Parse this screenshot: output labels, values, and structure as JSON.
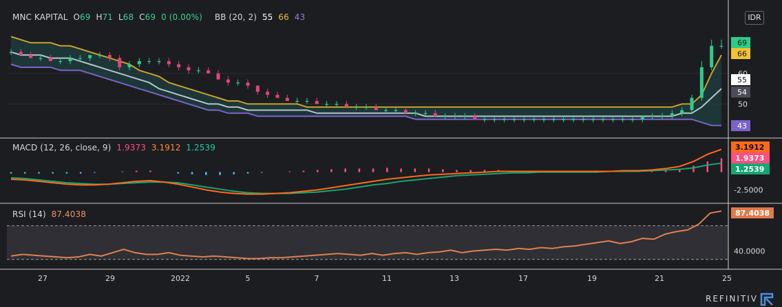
{
  "header": {
    "symbol": "MNC KAPITAL",
    "o_label": "O",
    "o": "69",
    "h_label": "H",
    "h": "71",
    "l_label": "L",
    "l": "68",
    "c_label": "C",
    "c": "69",
    "change": "0 (0.00%)",
    "bb_label": "BB (20, 2)",
    "bb_mid": "55",
    "bb_upper": "66",
    "bb_lower": "43",
    "currency": "IDR"
  },
  "macd_header": {
    "label": "MACD (12, 26, close, 9)",
    "hist": "1.9373",
    "macd": "3.1912",
    "signal": "1.2539"
  },
  "rsi_header": {
    "label": "RSI (14)",
    "value": "87.4038"
  },
  "footer": {
    "brand": "REFINITIV"
  },
  "colors": {
    "up": "#2ecc8a",
    "down": "#e0457b",
    "bb_upper": "#c9a227",
    "bb_mid": "#b8c4c9",
    "bb_lower": "#7c63c9",
    "macd": "#ff6a1a",
    "signal": "#17a673",
    "hist_pos": "#ff4f80",
    "hist_neg": "#4fc3f7",
    "rsi": "#e08050"
  },
  "chart_data": [
    {
      "type": "candlestick",
      "title": "MNC KAPITAL",
      "ylim": [
        40,
        75
      ],
      "yticks": [
        50,
        60
      ],
      "price_tags": [
        "69",
        "66",
        "55",
        "54",
        "43"
      ],
      "x_ticks": [
        "27",
        "29",
        "2022",
        "5",
        "7",
        "11",
        "13",
        "17",
        "19",
        "21",
        "25"
      ],
      "candles": [
        [
          67,
          68,
          66,
          67
        ],
        [
          67,
          68,
          66,
          66
        ],
        [
          66,
          67,
          65,
          65
        ],
        [
          65,
          66,
          64,
          65
        ],
        [
          65,
          66,
          64,
          64
        ],
        [
          64,
          65,
          63,
          64
        ],
        [
          64,
          66,
          63,
          65
        ],
        [
          65,
          66,
          64,
          65
        ],
        [
          65,
          66,
          64,
          66
        ],
        [
          66,
          67,
          65,
          66
        ],
        [
          66,
          67,
          64,
          65
        ],
        [
          65,
          66,
          61,
          62
        ],
        [
          62,
          64,
          61,
          63
        ],
        [
          63,
          65,
          62,
          64
        ],
        [
          64,
          65,
          63,
          64
        ],
        [
          64,
          65,
          63,
          64
        ],
        [
          64,
          65,
          62,
          63
        ],
        [
          63,
          64,
          61,
          62
        ],
        [
          62,
          63,
          60,
          61
        ],
        [
          61,
          62,
          60,
          61
        ],
        [
          61,
          62,
          60,
          60
        ],
        [
          60,
          61,
          58,
          58
        ],
        [
          58,
          59,
          56,
          57
        ],
        [
          57,
          58,
          56,
          57
        ],
        [
          57,
          58,
          55,
          56
        ],
        [
          56,
          56,
          53,
          54
        ],
        [
          54,
          55,
          52,
          53
        ],
        [
          53,
          54,
          52,
          52
        ],
        [
          52,
          53,
          51,
          51
        ],
        [
          51,
          52,
          50,
          51
        ],
        [
          51,
          52,
          50,
          51
        ],
        [
          51,
          52,
          50,
          50
        ],
        [
          50,
          51,
          49,
          50
        ],
        [
          50,
          51,
          49,
          50
        ],
        [
          50,
          51,
          49,
          49
        ],
        [
          49,
          50,
          48,
          49
        ],
        [
          49,
          50,
          48,
          49
        ],
        [
          49,
          50,
          48,
          48
        ],
        [
          48,
          49,
          47,
          48
        ],
        [
          48,
          49,
          47,
          48
        ],
        [
          48,
          49,
          47,
          47
        ],
        [
          47,
          48,
          46,
          47
        ],
        [
          47,
          48,
          46,
          47
        ],
        [
          47,
          48,
          46,
          46
        ],
        [
          46,
          47,
          45,
          46
        ],
        [
          46,
          47,
          45,
          46
        ],
        [
          46,
          47,
          45,
          46
        ],
        [
          46,
          47,
          45,
          45
        ],
        [
          45,
          46,
          44,
          45
        ],
        [
          45,
          46,
          44,
          45
        ],
        [
          45,
          46,
          44,
          45
        ],
        [
          45,
          46,
          44,
          45
        ],
        [
          45,
          46,
          44,
          45
        ],
        [
          45,
          46,
          44,
          45
        ],
        [
          45,
          46,
          44,
          45
        ],
        [
          45,
          46,
          44,
          45
        ],
        [
          45,
          46,
          44,
          45
        ],
        [
          45,
          46,
          44,
          45
        ],
        [
          45,
          46,
          44,
          45
        ],
        [
          45,
          46,
          44,
          45
        ],
        [
          45,
          46,
          44,
          45
        ],
        [
          45,
          46,
          44,
          45
        ],
        [
          45,
          46,
          44,
          45
        ],
        [
          45,
          46,
          44,
          45
        ],
        [
          45,
          46,
          44,
          46
        ],
        [
          46,
          47,
          45,
          46
        ],
        [
          46,
          47,
          45,
          46
        ],
        [
          46,
          48,
          45,
          47
        ],
        [
          47,
          49,
          46,
          48
        ],
        [
          48,
          53,
          47,
          52
        ],
        [
          52,
          64,
          51,
          62
        ],
        [
          62,
          71,
          61,
          69
        ],
        [
          69,
          71,
          68,
          69
        ]
      ],
      "bb_upper": [
        72,
        71,
        70,
        70,
        70,
        69,
        69,
        68,
        67,
        66,
        65,
        64,
        63,
        61,
        60,
        59,
        57,
        56,
        55,
        54,
        53,
        52,
        51,
        51,
        50,
        50,
        50,
        50,
        50,
        50,
        49,
        49,
        49,
        49,
        49,
        49,
        49,
        49,
        49,
        49,
        49,
        49,
        49,
        49,
        49,
        49,
        49,
        49,
        49,
        49,
        49,
        49,
        49,
        49,
        49,
        49,
        49,
        49,
        49,
        49,
        49,
        49,
        49,
        49,
        49,
        49,
        49,
        49,
        50,
        50,
        53,
        60,
        66
      ],
      "bb_mid": [
        67,
        66,
        66,
        66,
        65,
        65,
        65,
        64,
        63,
        62,
        61,
        60,
        59,
        58,
        57,
        55,
        54,
        53,
        52,
        51,
        50,
        50,
        49,
        49,
        48,
        48,
        48,
        48,
        48,
        48,
        48,
        47,
        47,
        47,
        47,
        47,
        47,
        47,
        47,
        47,
        47,
        47,
        46,
        46,
        46,
        46,
        46,
        46,
        46,
        46,
        46,
        46,
        46,
        46,
        46,
        46,
        46,
        46,
        46,
        46,
        46,
        46,
        46,
        46,
        46,
        46,
        46,
        46,
        47,
        47,
        49,
        52,
        55
      ],
      "bb_lower": [
        63,
        62,
        62,
        62,
        62,
        61,
        61,
        61,
        60,
        59,
        58,
        57,
        56,
        55,
        54,
        53,
        52,
        51,
        50,
        49,
        48,
        48,
        47,
        47,
        47,
        46,
        46,
        46,
        46,
        46,
        46,
        46,
        46,
        46,
        46,
        46,
        46,
        46,
        46,
        46,
        46,
        45,
        45,
        45,
        45,
        45,
        45,
        45,
        45,
        45,
        45,
        45,
        45,
        45,
        45,
        45,
        45,
        45,
        45,
        45,
        45,
        45,
        45,
        45,
        45,
        45,
        45,
        45,
        45,
        45,
        44,
        43,
        43
      ]
    },
    {
      "type": "line",
      "title": "MACD (12, 26, close, 9)",
      "ylim": [
        -4,
        4.5
      ],
      "yticks": [
        -2.5
      ],
      "series": [
        {
          "name": "MACD",
          "values": [
            -1,
            -1.1,
            -1.3,
            -1.5,
            -1.7,
            -1.8,
            -1.8,
            -1.7,
            -1.5,
            -1.3,
            -1.2,
            -1.4,
            -1.7,
            -2.1,
            -2.5,
            -2.8,
            -3.0,
            -3.1,
            -3.1,
            -3.0,
            -2.9,
            -2.7,
            -2.5,
            -2.2,
            -1.9,
            -1.6,
            -1.3,
            -1.0,
            -0.8,
            -0.6,
            -0.4,
            -0.3,
            -0.2,
            -0.1,
            0,
            0.1,
            0.1,
            0.1,
            0.1,
            0.1,
            0.1,
            0.1,
            0.1,
            0.1,
            0.2,
            0.2,
            0.3,
            0.5,
            0.8,
            1.5,
            2.5,
            3.2
          ]
        },
        {
          "name": "Signal",
          "values": [
            -0.8,
            -0.9,
            -1.1,
            -1.3,
            -1.5,
            -1.6,
            -1.7,
            -1.7,
            -1.6,
            -1.5,
            -1.4,
            -1.4,
            -1.5,
            -1.8,
            -2.1,
            -2.4,
            -2.7,
            -2.9,
            -3.0,
            -3.0,
            -3.0,
            -2.9,
            -2.8,
            -2.6,
            -2.4,
            -2.1,
            -1.8,
            -1.6,
            -1.3,
            -1.1,
            -0.9,
            -0.7,
            -0.5,
            -0.4,
            -0.3,
            -0.2,
            -0.1,
            -0.1,
            0,
            0,
            0,
            0,
            0,
            0.1,
            0.1,
            0.1,
            0.2,
            0.3,
            0.4,
            0.6,
            1.0,
            1.25
          ]
        },
        {
          "name": "Histogram",
          "values": [
            -0.2,
            -0.2,
            -0.2,
            -0.2,
            -0.2,
            -0.2,
            -0.1,
            0,
            0.1,
            0.2,
            0.2,
            0,
            -0.2,
            -0.3,
            -0.4,
            -0.4,
            -0.3,
            -0.2,
            -0.1,
            0,
            0.1,
            0.2,
            0.3,
            0.4,
            0.5,
            0.5,
            0.5,
            0.6,
            0.5,
            0.5,
            0.5,
            0.4,
            0.3,
            0.3,
            0.3,
            0.3,
            0.2,
            0.2,
            0.1,
            0.1,
            0.1,
            0.1,
            0.1,
            0,
            0.1,
            0.1,
            0.1,
            0.2,
            0.4,
            0.9,
            1.5,
            1.94
          ]
        }
      ]
    },
    {
      "type": "line",
      "title": "RSI (14)",
      "ylim": [
        20,
        95
      ],
      "yticks": [
        40
      ],
      "band": [
        30,
        70
      ],
      "series": [
        {
          "name": "RSI",
          "values": [
            34,
            36,
            35,
            34,
            33,
            32,
            33,
            36,
            34,
            38,
            42,
            38,
            36,
            36,
            38,
            35,
            34,
            33,
            34,
            33,
            32,
            31,
            31,
            32,
            32,
            33,
            34,
            35,
            36,
            37,
            36,
            35,
            37,
            35,
            37,
            38,
            36,
            38,
            39,
            41,
            38,
            40,
            41,
            42,
            41,
            43,
            42,
            44,
            43,
            45,
            46,
            48,
            50,
            52,
            49,
            51,
            55,
            54,
            60,
            63,
            65,
            72,
            85,
            87.4
          ]
        }
      ]
    }
  ]
}
